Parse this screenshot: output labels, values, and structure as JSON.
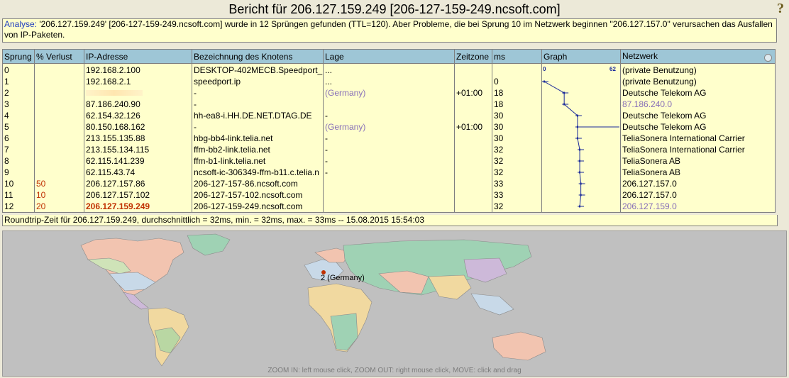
{
  "title": "Bericht für 206.127.159.249 [206-127-159-249.ncsoft.com]",
  "help_icon": "question-mark-icon",
  "analysis": {
    "label": "Analyse:",
    "text": "'206.127.159.249' [206-127-159-249.ncsoft.com] wurde in 12 Sprüngen gefunden (TTL=120). Aber Probleme, die bei Sprung 10 im Netzwerk beginnen \"206.127.157.0\" verursachen das Ausfallen von IP-Paketen."
  },
  "table": {
    "headers": [
      "Sprung",
      "% Verlust",
      "IP-Adresse",
      "Bezeichnung des Knotens",
      "Lage",
      "Zeitzone",
      "ms",
      "Graph",
      "Netzwerk"
    ],
    "rows": [
      {
        "hop": "0",
        "loss": "",
        "ip": "192.168.2.100",
        "node": "DESKTOP-402MECB.Speedport_",
        "loc": "...",
        "tz": "",
        "ms": "",
        "net": "(private Benutzung)"
      },
      {
        "hop": "1",
        "loss": "",
        "ip": "192.168.2.1",
        "node": "speedport.ip",
        "loc": "...",
        "tz": "",
        "ms": "0",
        "net": "(private Benutzung)"
      },
      {
        "hop": "2",
        "loss": "",
        "ip": "",
        "node": "-",
        "loc": "(Germany)",
        "tz": "+01:00",
        "ms": "18",
        "net": "Deutsche Telekom AG"
      },
      {
        "hop": "3",
        "loss": "",
        "ip": "87.186.240.90",
        "node": "-",
        "loc": "",
        "tz": "",
        "ms": "18",
        "net": "87.186.240.0"
      },
      {
        "hop": "4",
        "loss": "",
        "ip": "62.154.32.126",
        "node": "hh-ea8-i.HH.DE.NET.DTAG.DE",
        "loc": "-",
        "tz": "",
        "ms": "30",
        "net": "Deutsche Telekom AG"
      },
      {
        "hop": "5",
        "loss": "",
        "ip": "80.150.168.162",
        "node": "-",
        "loc": "(Germany)",
        "tz": "+01:00",
        "ms": "30",
        "net": "Deutsche Telekom AG"
      },
      {
        "hop": "6",
        "loss": "",
        "ip": "213.155.135.88",
        "node": "hbg-bb4-link.telia.net",
        "loc": "-",
        "tz": "",
        "ms": "30",
        "net": "TeliaSonera International Carrier"
      },
      {
        "hop": "7",
        "loss": "",
        "ip": "213.155.134.115",
        "node": "ffm-bb2-link.telia.net",
        "loc": "-",
        "tz": "",
        "ms": "32",
        "net": "TeliaSonera International Carrier"
      },
      {
        "hop": "8",
        "loss": "",
        "ip": "62.115.141.239",
        "node": "ffm-b1-link.telia.net",
        "loc": "-",
        "tz": "",
        "ms": "32",
        "net": "TeliaSonera AB"
      },
      {
        "hop": "9",
        "loss": "",
        "ip": "62.115.43.74",
        "node": "ncsoft-ic-306349-ffm-b11.c.telia.n",
        "loc": "-",
        "tz": "",
        "ms": "32",
        "net": "TeliaSonera AB"
      },
      {
        "hop": "10",
        "loss": "50",
        "ip": "206.127.157.86",
        "node": "206-127-157-86.ncsoft.com",
        "loc": "",
        "tz": "",
        "ms": "33",
        "net": "206.127.157.0"
      },
      {
        "hop": "11",
        "loss": "10",
        "ip": "206.127.157.102",
        "node": "206-127-157-102.ncsoft.com",
        "loc": "",
        "tz": "",
        "ms": "33",
        "net": "206.127.157.0"
      },
      {
        "hop": "12",
        "loss": "20",
        "ip": "206.127.159.249",
        "node": "206-127-159-249.ncsoft.com",
        "loc": "",
        "tz": "",
        "ms": "32",
        "net": "206.127.159.0"
      }
    ],
    "graph_scale": {
      "min": "0",
      "max": "62"
    }
  },
  "footer": "Roundtrip-Zeit für 206.127.159.249, durchschnittlich = 32ms, min. = 32ms, max. = 33ms -- 15.08.2015 15:54:03",
  "map": {
    "marker_label": "2 (Germany)",
    "hint": "ZOOM IN: left mouse click, ZOOM OUT: right mouse click, MOVE: click and drag"
  }
}
